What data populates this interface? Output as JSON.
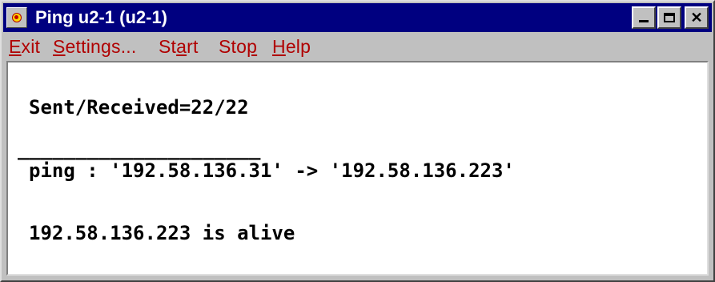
{
  "window": {
    "title": "Ping u2-1 (u2-1)",
    "icon": "ping-app-icon"
  },
  "title_buttons": {
    "minimize": "minimize-icon",
    "maximize": "maximize-icon",
    "close": "close-icon",
    "close_glyph": "✕"
  },
  "menu": {
    "exit": {
      "underline": "E",
      "rest": "xit"
    },
    "settings": {
      "underline": "S",
      "rest": "ettings..."
    },
    "start": {
      "before": "St",
      "underline": "a",
      "rest": "rt"
    },
    "stop": {
      "before": "Sto",
      "underline": "p",
      "rest": ""
    },
    "help": {
      "underline": "H",
      "rest": "elp"
    }
  },
  "output": {
    "sent_received": "Sent/Received=22/22",
    "separator": "_____________________",
    "ping_line": "ping : '192.58.136.31' -> '192.58.136.223'",
    "status": "192.58.136.223 is alive"
  },
  "colors": {
    "titlebar": "#000080",
    "menu_text": "#b00000",
    "face": "#c0c0c0"
  }
}
